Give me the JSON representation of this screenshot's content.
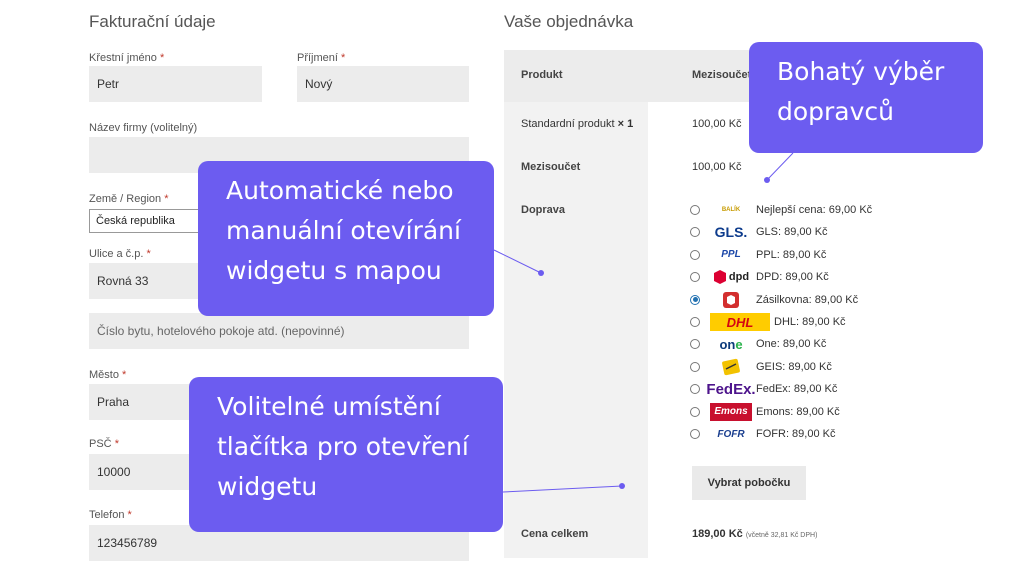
{
  "billing": {
    "title": "Fakturační údaje",
    "first_name": {
      "label": "Křestní jméno",
      "value": "Petr"
    },
    "last_name": {
      "label": "Příjmení",
      "value": "Nový"
    },
    "company": {
      "label": "Název firmy (volitelný)",
      "value": ""
    },
    "country": {
      "label": "Země / Region",
      "value": "Česká republika"
    },
    "street": {
      "label": "Ulice a č.p.",
      "value": "Rovná 33"
    },
    "apartment": {
      "placeholder": "Číslo bytu, hotelového pokoje atd. (nepovinné)"
    },
    "city": {
      "label": "Město",
      "value": "Praha"
    },
    "zip": {
      "label": "PSČ",
      "value": "10000"
    },
    "phone": {
      "label": "Telefon",
      "value": "123456789"
    },
    "required_mark": "*"
  },
  "order": {
    "title": "Vaše objednávka",
    "col_product": "Produkt",
    "col_subtotal": "Mezisoučet",
    "product_name": "Standardní produkt",
    "product_qty": "× 1",
    "product_price": "100,00 Kč",
    "subtotal_label": "Mezisoučet",
    "subtotal_value": "100,00 Kč",
    "shipping_label": "Doprava",
    "shipping_options": [
      {
        "label": "Nejlepší cena: 69,00 Kč",
        "icon": "balikobot-logo-icon",
        "logo_text": "BALÍK"
      },
      {
        "label": "GLS: 89,00 Kč",
        "icon": "gls-logo-icon",
        "logo_text": "GLS."
      },
      {
        "label": "PPL: 89,00 Kč",
        "icon": "ppl-logo-icon",
        "logo_text": "PPL"
      },
      {
        "label": "DPD: 89,00 Kč",
        "icon": "dpd-logo-icon",
        "logo_text": "dpd"
      },
      {
        "label": "Zásilkovna: 89,00 Kč",
        "icon": "zasilkovna-logo-icon",
        "logo_text": ""
      },
      {
        "label": "DHL: 89,00 Kč",
        "icon": "dhl-logo-icon",
        "logo_text": "DHL"
      },
      {
        "label": "One: 89,00 Kč",
        "icon": "one-logo-icon",
        "logo_text": "one"
      },
      {
        "label": "GEIS: 89,00 Kč",
        "icon": "geis-logo-icon",
        "logo_text": ""
      },
      {
        "label": "FedEx: 89,00 Kč",
        "icon": "fedex-logo-icon",
        "logo_text": "FedEx."
      },
      {
        "label": "Emons: 89,00 Kč",
        "icon": "emons-logo-icon",
        "logo_text": "Emons"
      },
      {
        "label": "FOFR: 89,00 Kč",
        "icon": "fofr-logo-icon",
        "logo_text": "FOFR"
      }
    ],
    "selected_shipping_index": 4,
    "pickup_button": "Vybrat pobočku",
    "total_label": "Cena celkem",
    "total_value": "189,00 Kč",
    "total_tax_note": "(včetně 32,81 Kč DPH)"
  },
  "callouts": {
    "carriers": [
      "Bohatý výběr",
      "dopravců"
    ],
    "widget_map": [
      "Automatické nebo",
      "manuální otevírání",
      "widgetu s mapou"
    ],
    "button_position": [
      "Volitelné umístění",
      "tlačítka pro otevření",
      "widgetu"
    ]
  },
  "colors": {
    "callout": "#6c5cf0",
    "accent": "#2271b1",
    "required": "#c0392b"
  }
}
